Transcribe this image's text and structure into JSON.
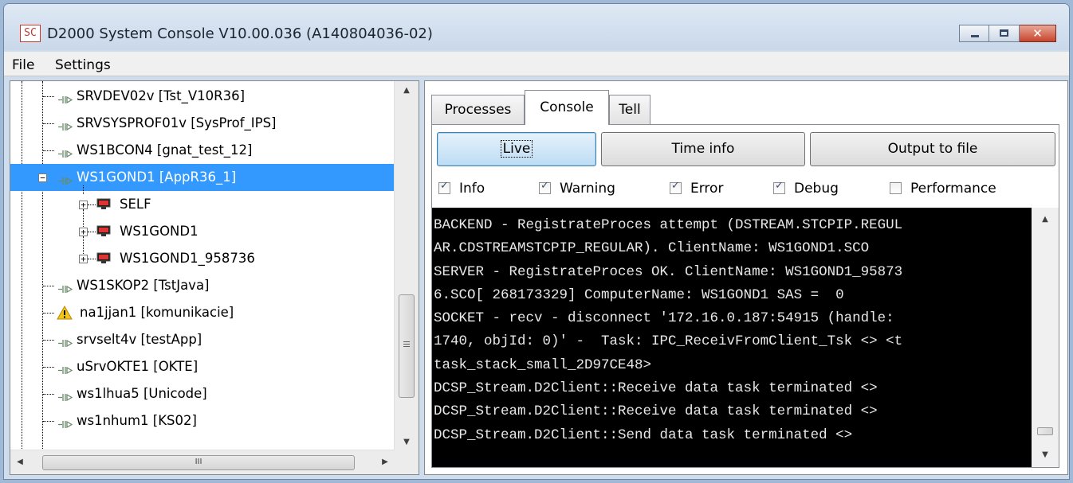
{
  "window": {
    "app_icon_text": "SC",
    "title": "D2000 System Console V10.00.036 (A140804036-02)",
    "controls": {
      "close_symbol": "✕"
    }
  },
  "menu": {
    "file": "File",
    "settings": "Settings"
  },
  "tree": {
    "items": [
      {
        "label": "SRVDEV02v [Tst_V10R36]",
        "icon": "connection-icon"
      },
      {
        "label": "SRVSYSPROF01v [SysProf_IPS]",
        "icon": "connection-icon"
      },
      {
        "label": "WS1BCON4 [gnat_test_12]",
        "icon": "connection-icon"
      },
      {
        "label": "WS1GOND1 [AppR36_1]",
        "icon": "connection-icon",
        "selected": true,
        "expanded": true
      },
      {
        "label": "SELF",
        "icon": "monitor-icon",
        "child": true
      },
      {
        "label": "WS1GOND1",
        "icon": "monitor-icon",
        "child": true
      },
      {
        "label": "WS1GOND1_958736",
        "icon": "monitor-icon",
        "child": true
      },
      {
        "label": "WS1SKOP2 [TstJava]",
        "icon": "connection-icon"
      },
      {
        "label": "na1jjan1 [komunikacie]",
        "icon": "warning-icon"
      },
      {
        "label": "srvselt4v [testApp]",
        "icon": "connection-icon"
      },
      {
        "label": "uSrvOKTE1 [OKTE]",
        "icon": "connection-icon"
      },
      {
        "label": "ws1lhua5 [Unicode]",
        "icon": "connection-icon"
      },
      {
        "label": "ws1nhum1 [KS02]",
        "icon": "connection-icon"
      }
    ],
    "scroll_up_symbol": "▲",
    "scroll_down_symbol": "▼",
    "scroll_left_symbol": "◀",
    "scroll_right_symbol": "▶",
    "hthumb_grip": "III"
  },
  "tabs": {
    "processes": "Processes",
    "console": "Console",
    "tell": "Tell",
    "active": "Console"
  },
  "console_panel": {
    "buttons": {
      "live": "Live",
      "time_info": "Time info",
      "output_to_file": "Output to file"
    },
    "filters": [
      {
        "label": "Info",
        "checked": true
      },
      {
        "label": "Warning",
        "checked": true
      },
      {
        "label": "Error",
        "checked": true
      },
      {
        "label": "Debug",
        "checked": true
      },
      {
        "label": "Performance",
        "checked": false
      }
    ],
    "lines": [
      "BACKEND - RegistrateProces attempt (DSTREAM.STCPIP.REGUL",
      "AR.CDSTREAMSTCPIP_REGULAR). ClientName: WS1GOND1.SCO",
      "SERVER - RegistrateProces OK. ClientName: WS1GOND1_95873",
      "6.SCO[ 268173329] ComputerName: WS1GOND1 SAS =  0",
      "SOCKET - recv - disconnect '172.16.0.187:54915 (handle:",
      "1740, objId: 0)' -  Task: IPC_ReceivFromClient_Tsk <> <t",
      "task_stack_small_2D97CE48>",
      "DCSP_Stream.D2Client::Receive data task terminated <>",
      "DCSP_Stream.D2Client::Receive data task terminated <>",
      "DCSP_Stream.D2Client::Send data task terminated <>"
    ]
  },
  "colors": {
    "selection": "#3399ff",
    "console_bg": "#000000",
    "console_fg": "#e8e8e8",
    "window_frame": "#cfdcec"
  }
}
